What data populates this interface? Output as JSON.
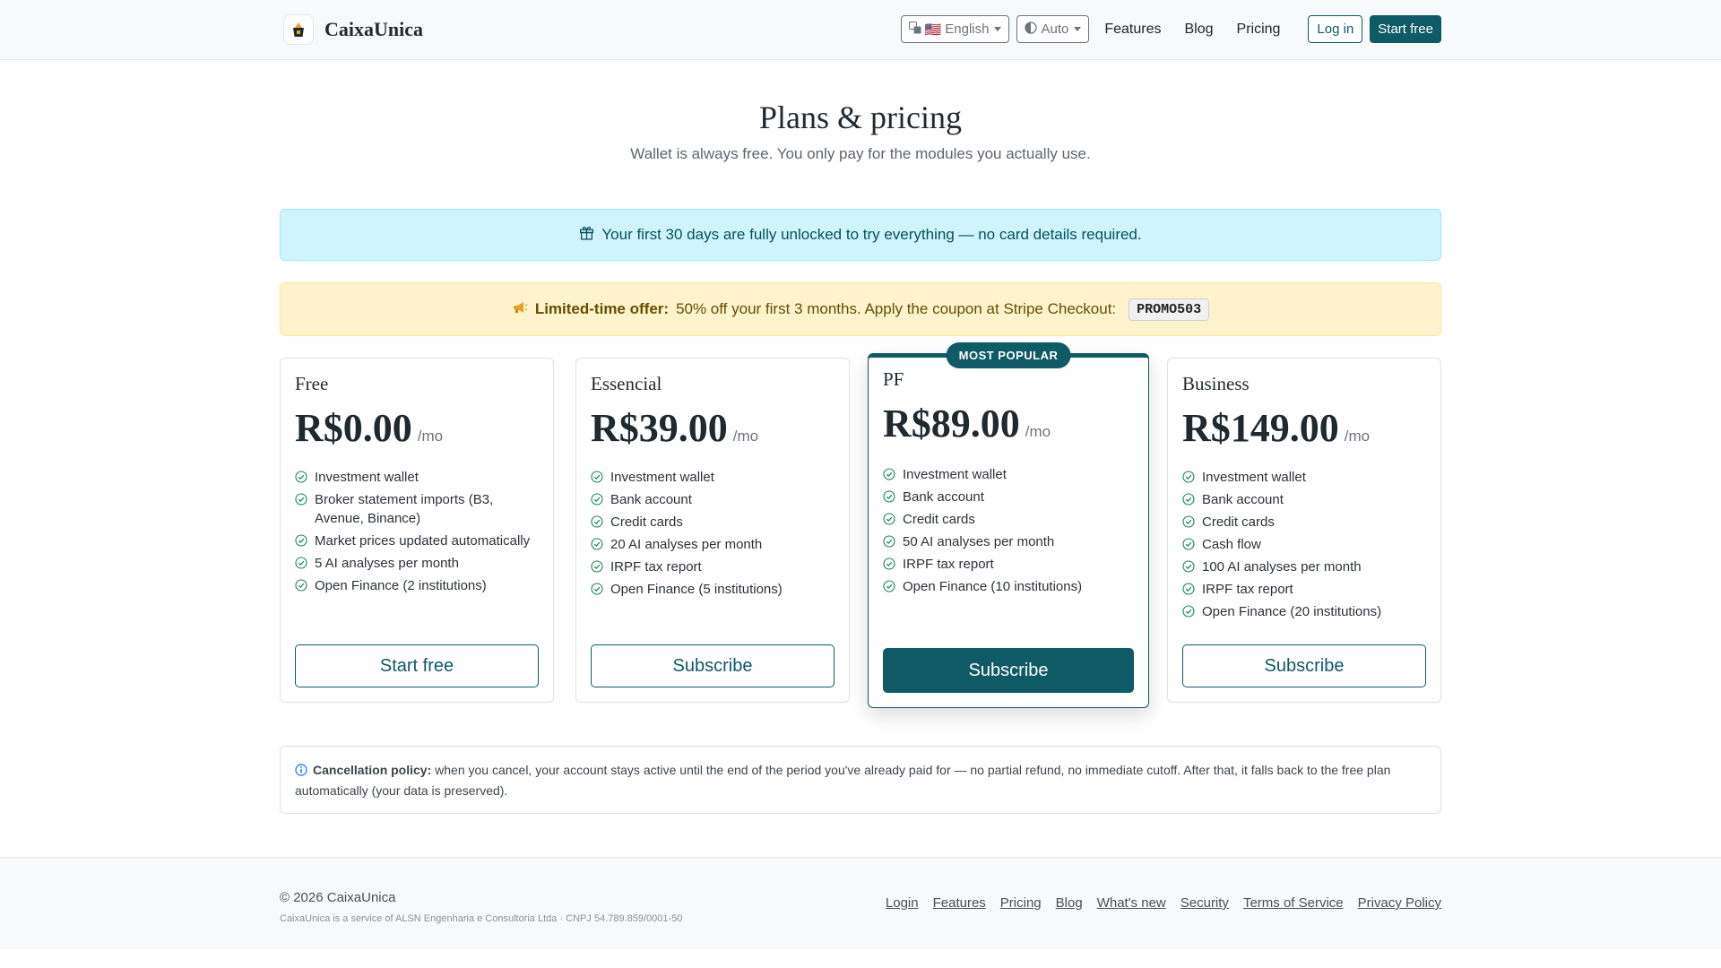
{
  "nav": {
    "brand": "CaixaUnica",
    "language": "English",
    "language_flag": "🇺🇸",
    "theme": "Auto",
    "links": [
      "Features",
      "Blog",
      "Pricing"
    ],
    "login": "Log in",
    "start_free": "Start free"
  },
  "hero": {
    "title": "Plans & pricing",
    "subtitle": "Wallet is always free. You only pay for the modules you actually use."
  },
  "alerts": {
    "trial": "Your first 30 days are fully unlocked to try everything — no card details required.",
    "offer_label": "Limited-time offer:",
    "offer_text": "50% off your first 3 months. Apply the coupon at Stripe Checkout:",
    "coupon": "PROMO503"
  },
  "plans": [
    {
      "name": "Free",
      "price": "R$0.00",
      "period": "/mo",
      "features": [
        "Investment wallet",
        "Broker statement imports (B3, Avenue, Binance)",
        "Market prices updated automatically",
        "5 AI analyses per month",
        "Open Finance (2 institutions)"
      ],
      "cta": "Start free"
    },
    {
      "name": "Essencial",
      "price": "R$39.00",
      "period": "/mo",
      "features": [
        "Investment wallet",
        "Bank account",
        "Credit cards",
        "20 AI analyses per month",
        "IRPF tax report",
        "Open Finance (5 institutions)"
      ],
      "cta": "Subscribe"
    },
    {
      "name": "PF",
      "price": "R$89.00",
      "period": "/mo",
      "badge": "MOST POPULAR",
      "features": [
        "Investment wallet",
        "Bank account",
        "Credit cards",
        "50 AI analyses per month",
        "IRPF tax report",
        "Open Finance (10 institutions)"
      ],
      "cta": "Subscribe"
    },
    {
      "name": "Business",
      "price": "R$149.00",
      "period": "/mo",
      "features": [
        "Investment wallet",
        "Bank account",
        "Credit cards",
        "Cash flow",
        "100 AI analyses per month",
        "IRPF tax report",
        "Open Finance (20 institutions)"
      ],
      "cta": "Subscribe"
    }
  ],
  "policy": {
    "label": "Cancellation policy:",
    "text": "when you cancel, your account stays active until the end of the period you've already paid for — no partial refund, no immediate cutoff. After that, it falls back to the free plan automatically (your data is preserved)."
  },
  "footer": {
    "copyright": "© 2026 CaixaUnica",
    "legal": "CaixaUnica is a service of ALSN Engenharia e Consultoria Ltda · CNPJ 54.789.859/0001-50",
    "links": [
      "Login",
      "Features",
      "Pricing",
      "Blog",
      "What's new",
      "Security",
      "Terms of Service",
      "Privacy Policy"
    ]
  },
  "colors": {
    "primary": "#0e5a66",
    "info_bg": "#cff4fc",
    "warn_bg": "#fff3cd",
    "check": "#198754"
  },
  "icons": {
    "brand": "brand-logo-icon",
    "language": "translate-icon",
    "theme": "half-circle-icon",
    "trial": "gift-icon",
    "offer": "megaphone-icon",
    "feature": "check-circle-icon",
    "policy": "info-circle-icon"
  }
}
